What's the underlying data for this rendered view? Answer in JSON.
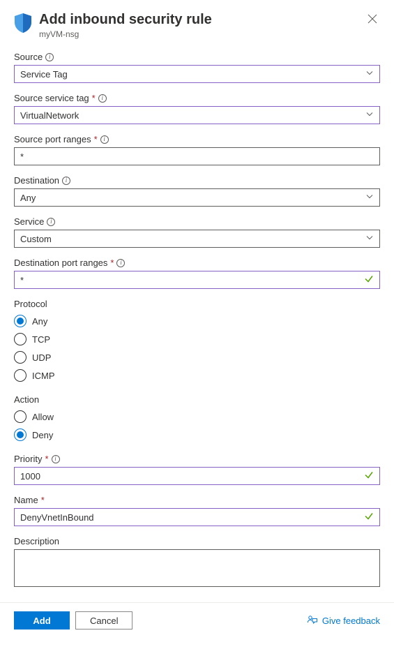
{
  "header": {
    "title": "Add inbound security rule",
    "subtitle": "myVM-nsg"
  },
  "fields": {
    "source": {
      "label": "Source",
      "value": "Service Tag"
    },
    "source_service_tag": {
      "label": "Source service tag",
      "value": "VirtualNetwork"
    },
    "source_port_ranges": {
      "label": "Source port ranges",
      "value": "*"
    },
    "destination": {
      "label": "Destination",
      "value": "Any"
    },
    "service": {
      "label": "Service",
      "value": "Custom"
    },
    "destination_port_ranges": {
      "label": "Destination port ranges",
      "value": "*"
    },
    "protocol": {
      "label": "Protocol",
      "options": [
        "Any",
        "TCP",
        "UDP",
        "ICMP"
      ],
      "selected": "Any"
    },
    "action": {
      "label": "Action",
      "options": [
        "Allow",
        "Deny"
      ],
      "selected": "Deny"
    },
    "priority": {
      "label": "Priority",
      "value": "1000"
    },
    "name": {
      "label": "Name",
      "value": "DenyVnetInBound"
    },
    "description": {
      "label": "Description",
      "value": ""
    }
  },
  "footer": {
    "primary": "Add",
    "secondary": "Cancel",
    "feedback": "Give feedback"
  }
}
